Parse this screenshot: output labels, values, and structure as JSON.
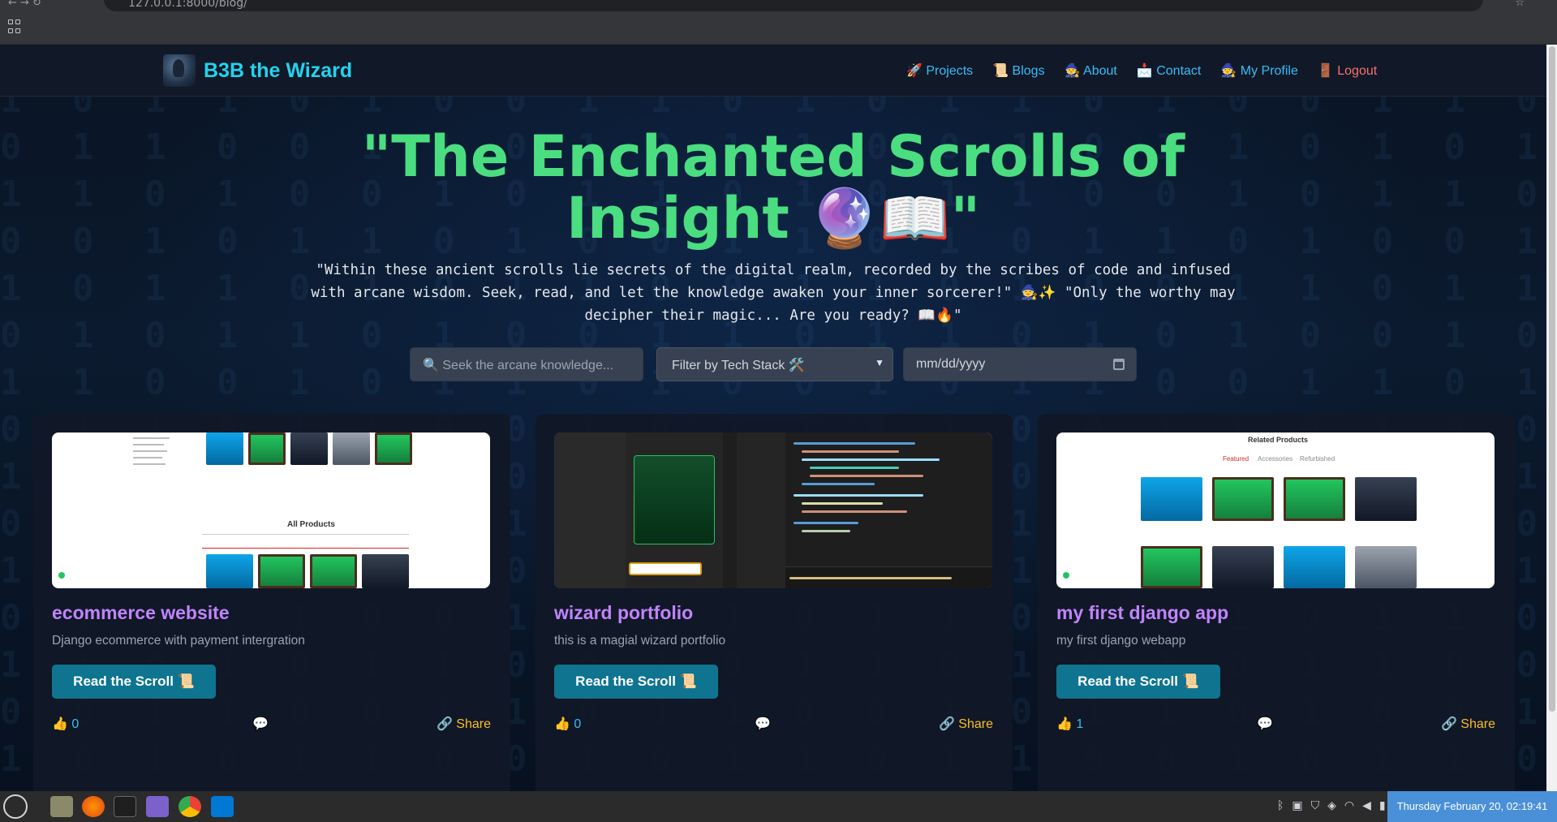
{
  "browser": {
    "url": "127.0.0.1:8000/blog/"
  },
  "site": {
    "brand": "B3B the Wizard",
    "nav": [
      {
        "label": "🚀 Projects"
      },
      {
        "label": "📜 Blogs"
      },
      {
        "label": "🧙 About"
      },
      {
        "label": "📩 Contact"
      },
      {
        "label": "🧙 My Profile"
      },
      {
        "label": "🚪 Logout"
      }
    ]
  },
  "hero": {
    "title": "\"The Enchanted Scrolls of Insight 🔮📖\"",
    "description": "\"Within these ancient scrolls lie secrets of the digital realm, recorded by the scribes of code and infused with arcane wisdom. Seek, read, and let the knowledge awaken your inner sorcerer!\" 🧙✨ \"Only the worthy may decipher their magic... Are you ready? 📖🔥\""
  },
  "filters": {
    "search_placeholder": "🔍 Seek the arcane knowledge...",
    "tech_select": "Filter by Tech Stack 🛠️",
    "date_placeholder": "mm/dd/yyyy"
  },
  "cards": [
    {
      "title": "ecommerce website",
      "description": "Django ecommerce with payment intergration",
      "button": "Read the Scroll 📜",
      "likes": "👍 0",
      "comment_icon": "💬",
      "share": "🔗 Share"
    },
    {
      "title": "wizard portfolio",
      "description": "this is a magial wizard portfolio",
      "button": "Read the Scroll 📜",
      "likes": "👍 0",
      "comment_icon": "💬",
      "share": "🔗 Share"
    },
    {
      "title": "my first django app",
      "description": "my first django webapp",
      "button": "Read the Scroll 📜",
      "likes": "👍 1",
      "comment_icon": "💬",
      "share": "🔗 Share"
    }
  ],
  "card_images": {
    "ecommerce": {
      "heading": "All Products"
    },
    "django_app": {
      "heading": "Related Products",
      "tabs": [
        "Featured",
        "Accessories",
        "Refurbished"
      ]
    }
  },
  "taskbar": {
    "clock": "Thursday February 20, 02:19:41"
  },
  "colors": {
    "accent": "#22d3ee",
    "title_green": "#4ade80",
    "card_title": "#c084fc",
    "button": "#0e7490",
    "logout": "#f87171",
    "share": "#fbbf24"
  }
}
